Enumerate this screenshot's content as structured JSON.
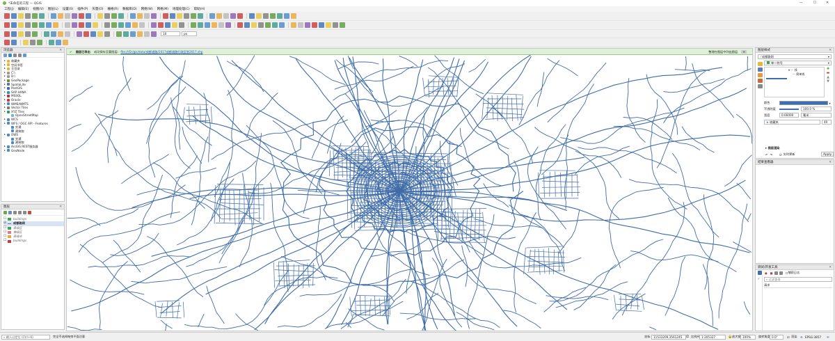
{
  "window": {
    "title": "*未命名的工程 — QGIS",
    "min": "—",
    "max": "☐",
    "close": "✕"
  },
  "menu": [
    "工程(J)",
    "编辑(E)",
    "视图(V)",
    "图层(L)",
    "设置(S)",
    "插件(P)",
    "矢量(O)",
    "栅格(R)",
    "数据库(D)",
    "网络(W)",
    "网格(M)",
    "地理处理(C)",
    "帮助(H)"
  ],
  "toolbar": {
    "scale_field_value": "10",
    "unit_value": "px"
  },
  "browser": {
    "title": "浏览器",
    "items": [
      {
        "label": "收藏夹",
        "color": "#e8b23a",
        "indent": 1
      },
      {
        "label": "空间书签",
        "color": "#e8b23a",
        "indent": 1
      },
      {
        "label": "主目录",
        "color": "#e8b23a",
        "indent": 1
      },
      {
        "label": "C:\\",
        "color": "#9a9a9a",
        "indent": 1
      },
      {
        "label": "D:\\",
        "color": "#9a9a9a",
        "indent": 1
      },
      {
        "label": "GeoPackage",
        "color": "#5a9a3a",
        "indent": 1
      },
      {
        "label": "SpatiaLite",
        "color": "#6a6ab0",
        "indent": 1
      },
      {
        "label": "PostGIS",
        "color": "#3a6aa8",
        "indent": 1
      },
      {
        "label": "SAP HANA",
        "color": "#3a8ac8",
        "indent": 1
      },
      {
        "label": "MSSQL",
        "color": "#a83a3a",
        "indent": 1
      },
      {
        "label": "Oracle",
        "color": "#c83a3a",
        "indent": 1
      },
      {
        "label": "WMS/WMTS",
        "color": "#4a8ac8",
        "indent": 1
      },
      {
        "label": "Vector Tiles",
        "color": "#7a7a7a",
        "indent": 1
      },
      {
        "label": "XYZ Tiles",
        "color": "#3a9a5a",
        "indent": 1
      },
      {
        "label": "OpenStreetMap",
        "color": "#7ab0d8",
        "indent": 2
      },
      {
        "label": "WCS",
        "color": "#4a8ac8",
        "indent": 1
      },
      {
        "label": "WFS / OGC API - Features",
        "color": "#4a8ac8",
        "indent": 1
      },
      {
        "label": "交通",
        "color": "#4a8ac8",
        "indent": 2
      },
      {
        "label": "建筑物",
        "color": "#4a8ac8",
        "indent": 2
      },
      {
        "label": "OWS",
        "color": "#4a8ac8",
        "indent": 1
      },
      {
        "label": "交通",
        "color": "#4a8ac8",
        "indent": 2
      },
      {
        "label": "建筑物",
        "color": "#4a8ac8",
        "indent": 2
      },
      {
        "label": "ArcGIS REST服务器",
        "color": "#4a8ac8",
        "indent": 1
      },
      {
        "label": "GeoNode",
        "color": "#4a8ac8",
        "indent": 1
      }
    ]
  },
  "layers": {
    "title": "图层",
    "items": [
      {
        "label": "buildings",
        "color": "#3aa84a",
        "checked": false
      },
      {
        "label": "成都路网",
        "color": "#4a6fb0",
        "checked": true
      },
      {
        "label": "县级区",
        "color": "#3aa84a",
        "checked": false
      },
      {
        "label": "镇级区",
        "color": "#d87a8a",
        "checked": false
      },
      {
        "label": "县级市",
        "color": "#e8a83a",
        "checked": false
      },
      {
        "label": "buildings",
        "color": "#c83a3a",
        "checked": false
      }
    ]
  },
  "message": {
    "status": "图层已导出",
    "text": "成功保存至要图层:",
    "link": "file:///D:/gis/data/成都道路/2017成都道路行政区划2017.shp",
    "right": "整理在图层中列出图层"
  },
  "style_panel": {
    "title": "图层样式",
    "layer": "成都路网",
    "renderer": "单一符号",
    "tree_line": "线",
    "tree_simple": "简单线",
    "color_label": "颜色",
    "opacity_label": "不透明度",
    "opacity_value": "100.0 %",
    "width_label": "宽度",
    "width_value": "0.66000",
    "unit_value": "毫米",
    "favorites": "收藏夹",
    "angle": "40",
    "layer_render": "图层渲染",
    "live_update": "实时更新",
    "apply": "Apply"
  },
  "results": {
    "title": "结果查看器"
  },
  "devtools": {
    "title": "调试/开发工具",
    "capture": "捕获日志",
    "filter_placeholder": "过滤查询",
    "request_label": "请求"
  },
  "status": {
    "locator_placeholder": "输入以定位 (Ctrl+K)",
    "message": "完全不选择拖曳平面注意",
    "coord_label": "坐标",
    "coord_value": "11533209,3561245",
    "scale_label": "比例尺",
    "scale_value": "1:205327",
    "magnifier_label": "放大镜",
    "magnifier_value": "100%",
    "rotation_label": "旋转角度",
    "rotation_value": "0.0°",
    "render_label": "渲染",
    "crs": "EPSG:3857"
  },
  "colors": {
    "road": "#3f6ca8",
    "accent": "#3a6fb5",
    "success_bg": "#dff0d8"
  }
}
